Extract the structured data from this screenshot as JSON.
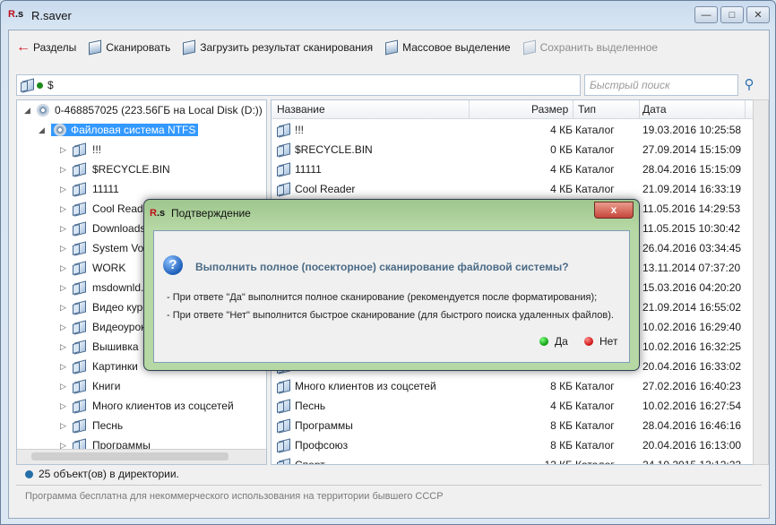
{
  "window": {
    "app_icon": "R.s",
    "title": "R.saver"
  },
  "toolbar": {
    "items": [
      {
        "label": "Разделы",
        "icon": "back-arrow-icon",
        "enabled": true
      },
      {
        "label": "Сканировать",
        "icon": "scan-icon",
        "enabled": true
      },
      {
        "label": "Загрузить результат сканирования",
        "icon": "load-icon",
        "enabled": true
      },
      {
        "label": "Массовое выделение",
        "icon": "mass-select-icon",
        "enabled": true
      },
      {
        "label": "Сохранить выделенное",
        "icon": "save-icon",
        "enabled": false
      }
    ]
  },
  "path": {
    "value": "$"
  },
  "search": {
    "placeholder": "Быстрый поиск"
  },
  "tree": {
    "disk": "0-468857025 (223.56ГБ на Local Disk (D:))",
    "filesystem": "Файловая система NTFS",
    "items": [
      "!!!",
      "$RECYCLE.BIN",
      "11111",
      "Cool Reader",
      "Downloads",
      "System Volume Information",
      "WORK",
      "msdownld.tmp",
      "Видео курс Python",
      "Видеоуроки",
      "Вышивка",
      "Картинки",
      "Книги",
      "Много клиентов из соцсетей",
      "Песнь",
      "Программы"
    ]
  },
  "grid": {
    "columns": {
      "name": "Название",
      "size": "Размер",
      "type": "Тип",
      "date": "Дата"
    },
    "rows": [
      {
        "name": "!!!",
        "size": "4 КБ",
        "type": "Каталог",
        "date": "19.03.2016 10:25:58"
      },
      {
        "name": "$RECYCLE.BIN",
        "size": "0 КБ",
        "type": "Каталог",
        "date": "27.09.2014 15:15:09"
      },
      {
        "name": "11111",
        "size": "4 КБ",
        "type": "Каталог",
        "date": "28.04.2016 15:15:09"
      },
      {
        "name": "Cool Reader",
        "size": "4 КБ",
        "type": "Каталог",
        "date": "21.09.2014 16:33:19"
      },
      {
        "name": "",
        "size": "",
        "type": "",
        "date": "11.05.2016 14:29:53"
      },
      {
        "name": "",
        "size": "",
        "type": "",
        "date": "11.05.2015 10:30:42"
      },
      {
        "name": "",
        "size": "",
        "type": "",
        "date": "26.04.2016 03:34:45"
      },
      {
        "name": "",
        "size": "",
        "type": "",
        "date": "13.11.2014 07:37:20"
      },
      {
        "name": "",
        "size": "",
        "type": "",
        "date": "15.03.2016 04:20:20"
      },
      {
        "name": "",
        "size": "",
        "type": "",
        "date": "21.09.2014 16:55:02"
      },
      {
        "name": "",
        "size": "",
        "type": "",
        "date": "10.02.2016 16:29:40"
      },
      {
        "name": "",
        "size": "",
        "type": "",
        "date": "10.02.2016 16:32:25"
      },
      {
        "name": "",
        "size": "",
        "type": "",
        "date": "20.04.2016 16:33:02"
      },
      {
        "name": "Много клиентов из соцсетей",
        "size": "8 КБ",
        "type": "Каталог",
        "date": "27.02.2016 16:40:23"
      },
      {
        "name": "Песнь",
        "size": "4 КБ",
        "type": "Каталог",
        "date": "10.02.2016 16:27:54"
      },
      {
        "name": "Программы",
        "size": "8 КБ",
        "type": "Каталог",
        "date": "28.04.2016 16:46:16"
      },
      {
        "name": "Профсоюз",
        "size": "8 КБ",
        "type": "Каталог",
        "date": "20.04.2016 16:13:00"
      },
      {
        "name": "Спорт",
        "size": "12 КБ",
        "type": "Каталог",
        "date": "24.10.2015 13:12:22"
      }
    ]
  },
  "status": {
    "text": "25 объект(ов) в директории."
  },
  "footer": {
    "text": "Программа бесплатна для некоммерческого использования на территории бывшего СССР"
  },
  "dialog": {
    "icon": "R.s",
    "title": "Подтверждение",
    "close": "x",
    "question": "Выполнить полное (посекторное) сканирование файловой системы?",
    "hint_yes": "- При ответе \"Да\" выполнится полное сканирование (рекомендуется после форматирования);",
    "hint_no": "- При ответе \"Нет\" выполнится быстрое сканирование (для быстрого поиска удаленных файлов).",
    "yes": "Да",
    "no": "Нет"
  }
}
